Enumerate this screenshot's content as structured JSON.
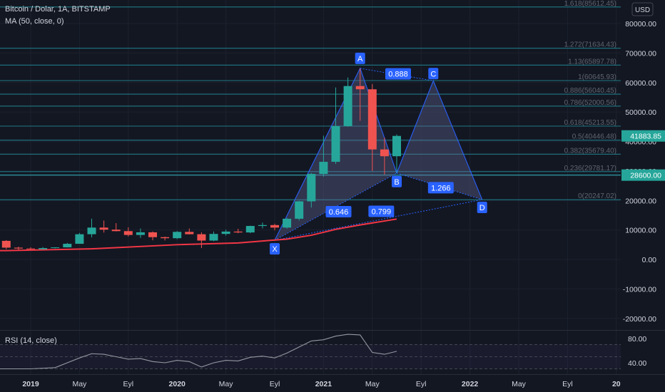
{
  "header": {
    "symbol": "Bitcoin / Dolar, 1A, BITSTAMP",
    "indicator": "MA (50, close, 0)",
    "currency_button": "USD"
  },
  "rsi_pane": {
    "label": "RSI (14, close)",
    "ticks": [
      "80.00",
      "40.00"
    ]
  },
  "price_axis": {
    "ticks": [
      "80000.00",
      "70000.00",
      "60000.00",
      "50000.00",
      "40000.00",
      "30000.00",
      "20000.00",
      "10000.00",
      "0.00",
      "-10000.00",
      "-20000.00"
    ],
    "last_price_badge": "41883.85",
    "line_badge": "28600.00"
  },
  "time_axis": {
    "ticks": [
      "2019",
      "May",
      "Eyl",
      "2020",
      "May",
      "Eyl",
      "2021",
      "May",
      "Eyl",
      "2022",
      "May",
      "Eyl",
      "20"
    ]
  },
  "fib_levels": [
    {
      "label": "1.618(85612.45)",
      "price": 85612.45
    },
    {
      "label": "1.272(71634.43)",
      "price": 71634.43
    },
    {
      "label": "1.13(65897.78)",
      "price": 65897.78
    },
    {
      "label": "1(60645.93)",
      "price": 60645.93
    },
    {
      "label": "0.886(56040.45)",
      "price": 56040.45
    },
    {
      "label": "0.786(52000.56)",
      "price": 52000.56
    },
    {
      "label": "0.618(45213.55)",
      "price": 45213.55
    },
    {
      "label": "0.5(40446.48)",
      "price": 40446.48
    },
    {
      "label": "0.382(35679.40)",
      "price": 35679.4
    },
    {
      "label": "0.236(29781.17)",
      "price": 29781.17
    },
    {
      "label": "0(20247.02)",
      "price": 20247.02
    }
  ],
  "pattern": {
    "points": [
      {
        "label": "X",
        "date": "2020-09",
        "price": 6500
      },
      {
        "label": "A",
        "date": "2021-04",
        "price": 64800
      },
      {
        "label": "B",
        "date": "2021-07",
        "price": 29300
      },
      {
        "label": "C",
        "date": "2021-10",
        "price": 60600
      },
      {
        "label": "D",
        "date": "2022-02",
        "price": 20300
      }
    ],
    "ratios": [
      "0.888",
      "0.646",
      "1.266",
      "0.799"
    ]
  },
  "colors": {
    "background": "#131722",
    "up": "#26a69a",
    "down": "#ef5350",
    "ma": "#f23645",
    "pattern_line": "#2962ff",
    "pattern_fill": "#6b6e9e",
    "fib_line": "#1f7f8a",
    "badge_blue": "#2962ff",
    "badge_teal": "#26a69a"
  },
  "chart_data": {
    "type": "candlestick",
    "title": "Bitcoin / Dolar, 1A, BITSTAMP",
    "interval": "1 month",
    "ylim": [
      -25000,
      90000
    ],
    "candles": [
      {
        "date": "2018-11",
        "open": 6300,
        "high": 6550,
        "low": 3500,
        "close": 4000
      },
      {
        "date": "2018-12",
        "open": 4000,
        "high": 4300,
        "low": 3200,
        "close": 3700
      },
      {
        "date": "2019-01",
        "open": 3700,
        "high": 4100,
        "low": 3400,
        "close": 3450
      },
      {
        "date": "2019-02",
        "open": 3450,
        "high": 4200,
        "low": 3400,
        "close": 3850
      },
      {
        "date": "2019-03",
        "open": 3850,
        "high": 4150,
        "low": 3750,
        "close": 4100
      },
      {
        "date": "2019-04",
        "open": 4100,
        "high": 5600,
        "low": 4050,
        "close": 5300
      },
      {
        "date": "2019-05",
        "open": 5300,
        "high": 9000,
        "low": 5300,
        "close": 8550
      },
      {
        "date": "2019-06",
        "open": 8550,
        "high": 13800,
        "low": 7500,
        "close": 10800
      },
      {
        "date": "2019-07",
        "open": 10800,
        "high": 13200,
        "low": 9100,
        "close": 10100
      },
      {
        "date": "2019-08",
        "open": 10100,
        "high": 12300,
        "low": 9500,
        "close": 9600
      },
      {
        "date": "2019-09",
        "open": 9600,
        "high": 10900,
        "low": 7800,
        "close": 8300
      },
      {
        "date": "2019-10",
        "open": 8300,
        "high": 10500,
        "low": 7300,
        "close": 9200
      },
      {
        "date": "2019-11",
        "open": 9200,
        "high": 9500,
        "low": 6500,
        "close": 7550
      },
      {
        "date": "2019-12",
        "open": 7550,
        "high": 7750,
        "low": 6430,
        "close": 7200
      },
      {
        "date": "2020-01",
        "open": 7200,
        "high": 9600,
        "low": 6900,
        "close": 9350
      },
      {
        "date": "2020-02",
        "open": 9350,
        "high": 10500,
        "low": 8500,
        "close": 8550
      },
      {
        "date": "2020-03",
        "open": 8550,
        "high": 9200,
        "low": 3850,
        "close": 6400
      },
      {
        "date": "2020-04",
        "open": 6400,
        "high": 9450,
        "low": 6200,
        "close": 8650
      },
      {
        "date": "2020-05",
        "open": 8650,
        "high": 10100,
        "low": 8100,
        "close": 9450
      },
      {
        "date": "2020-06",
        "open": 9450,
        "high": 10400,
        "low": 8900,
        "close": 9150
      },
      {
        "date": "2020-07",
        "open": 9150,
        "high": 11450,
        "low": 8900,
        "close": 11350
      },
      {
        "date": "2020-08",
        "open": 11350,
        "high": 12500,
        "low": 10500,
        "close": 11650
      },
      {
        "date": "2020-09",
        "open": 11650,
        "high": 12100,
        "low": 9900,
        "close": 10800
      },
      {
        "date": "2020-10",
        "open": 10800,
        "high": 14100,
        "low": 10400,
        "close": 13800
      },
      {
        "date": "2020-11",
        "open": 13800,
        "high": 19900,
        "low": 13200,
        "close": 19700
      },
      {
        "date": "2020-12",
        "open": 19700,
        "high": 29300,
        "low": 17600,
        "close": 29000
      },
      {
        "date": "2021-01",
        "open": 29000,
        "high": 41950,
        "low": 28100,
        "close": 33100
      },
      {
        "date": "2021-02",
        "open": 33100,
        "high": 58300,
        "low": 32400,
        "close": 45200
      },
      {
        "date": "2021-03",
        "open": 45200,
        "high": 61700,
        "low": 45000,
        "close": 58800
      },
      {
        "date": "2021-04",
        "open": 58800,
        "high": 64800,
        "low": 47000,
        "close": 57700
      },
      {
        "date": "2021-05",
        "open": 57700,
        "high": 59500,
        "low": 30000,
        "close": 37300
      },
      {
        "date": "2021-06",
        "open": 37300,
        "high": 41300,
        "low": 28800,
        "close": 35000
      },
      {
        "date": "2021-07",
        "open": 35000,
        "high": 42400,
        "low": 29300,
        "close": 41884
      }
    ],
    "ma_50": [
      {
        "date": "2018-11",
        "value": 3000
      },
      {
        "date": "2019-06",
        "value": 3600
      },
      {
        "date": "2020-01",
        "value": 5000
      },
      {
        "date": "2020-06",
        "value": 5600
      },
      {
        "date": "2020-10",
        "value": 6900
      },
      {
        "date": "2020-12",
        "value": 8200
      },
      {
        "date": "2021-02",
        "value": 10200
      },
      {
        "date": "2021-04",
        "value": 11700
      },
      {
        "date": "2021-07",
        "value": 13700
      }
    ],
    "rsi_14": [
      {
        "date": "2018-11",
        "value": 30
      },
      {
        "date": "2019-01",
        "value": 30
      },
      {
        "date": "2019-03",
        "value": 32
      },
      {
        "date": "2019-05",
        "value": 48
      },
      {
        "date": "2019-06",
        "value": 55
      },
      {
        "date": "2019-07",
        "value": 54
      },
      {
        "date": "2019-08",
        "value": 50
      },
      {
        "date": "2019-09",
        "value": 46
      },
      {
        "date": "2019-10",
        "value": 47
      },
      {
        "date": "2019-11",
        "value": 42
      },
      {
        "date": "2019-12",
        "value": 40
      },
      {
        "date": "2020-01",
        "value": 44
      },
      {
        "date": "2020-02",
        "value": 42
      },
      {
        "date": "2020-03",
        "value": 33
      },
      {
        "date": "2020-04",
        "value": 40
      },
      {
        "date": "2020-05",
        "value": 44
      },
      {
        "date": "2020-06",
        "value": 43
      },
      {
        "date": "2020-07",
        "value": 49
      },
      {
        "date": "2020-08",
        "value": 51
      },
      {
        "date": "2020-09",
        "value": 48
      },
      {
        "date": "2020-10",
        "value": 56
      },
      {
        "date": "2020-11",
        "value": 66
      },
      {
        "date": "2020-12",
        "value": 76
      },
      {
        "date": "2021-01",
        "value": 78
      },
      {
        "date": "2021-02",
        "value": 84
      },
      {
        "date": "2021-03",
        "value": 87
      },
      {
        "date": "2021-04",
        "value": 86
      },
      {
        "date": "2021-05",
        "value": 57
      },
      {
        "date": "2021-06",
        "value": 54
      },
      {
        "date": "2021-07",
        "value": 59
      }
    ]
  }
}
